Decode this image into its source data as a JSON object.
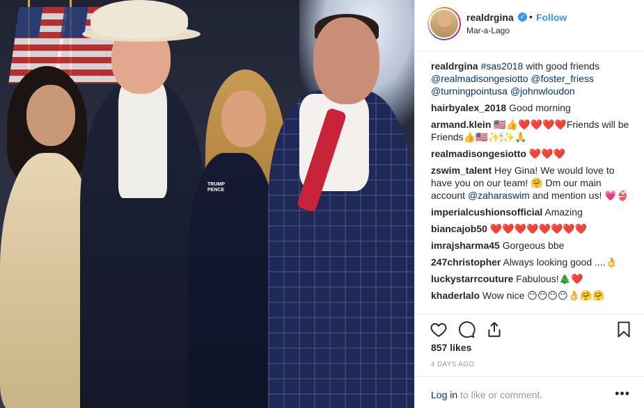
{
  "post": {
    "username": "realdrgina",
    "follow_label": "Follow",
    "dot": "•",
    "location": "Mar-a-Lago",
    "verified_mark": "✓",
    "caption": {
      "user": "realdrgina",
      "hashtag": "#sas2018",
      "text_after_hashtag": " with good friends",
      "mentions": [
        "@realmadisongesiotto",
        "@foster_friess",
        "@turningpointusa",
        "@johnwloudon"
      ]
    },
    "comments": [
      {
        "user": "hairbyalex_2018",
        "text": "Good morning"
      },
      {
        "user": "armand.klein",
        "text": "🇺🇸👍❤️❤️❤️❤️Friends will be Friends👍🇺🇸✨🕯✨🙏"
      },
      {
        "user": "realmadisongesiotto",
        "text": "❤️❤️❤️"
      },
      {
        "user": "zswim_talent",
        "text_before": "Hey Gina! We would love to have you on our team! 🤗  Dm our main account ",
        "mention": "@zaharaswim",
        "text_after": " and mention us! 💗👙"
      },
      {
        "user": "imperialcushionsofficial",
        "text": "Amazing"
      },
      {
        "user": "biancajob50",
        "text": "❤️❤️❤️❤️❤️❤️❤️❤️"
      },
      {
        "user": "imrajsharma45",
        "text": "Gorgeous bbe"
      },
      {
        "user": "247christopher",
        "text": "Always looking good ....👌"
      },
      {
        "user": "luckystarrcouture",
        "text": "Fabulous!🎄❤️"
      },
      {
        "user": "khaderlalo",
        "text": "Wow nice 😶😶😶😶👌🤗🤗"
      }
    ],
    "likes": "857 likes",
    "time_ago": "4 DAYS AGO",
    "login_link": "Log in",
    "login_rest": " to like or comment.",
    "more": "•••"
  },
  "photo": {
    "badge_text": "TRUMP PENCE"
  },
  "icons": {
    "like": "heart-icon",
    "comment": "comment-icon",
    "share": "share-icon",
    "save": "bookmark-icon"
  }
}
